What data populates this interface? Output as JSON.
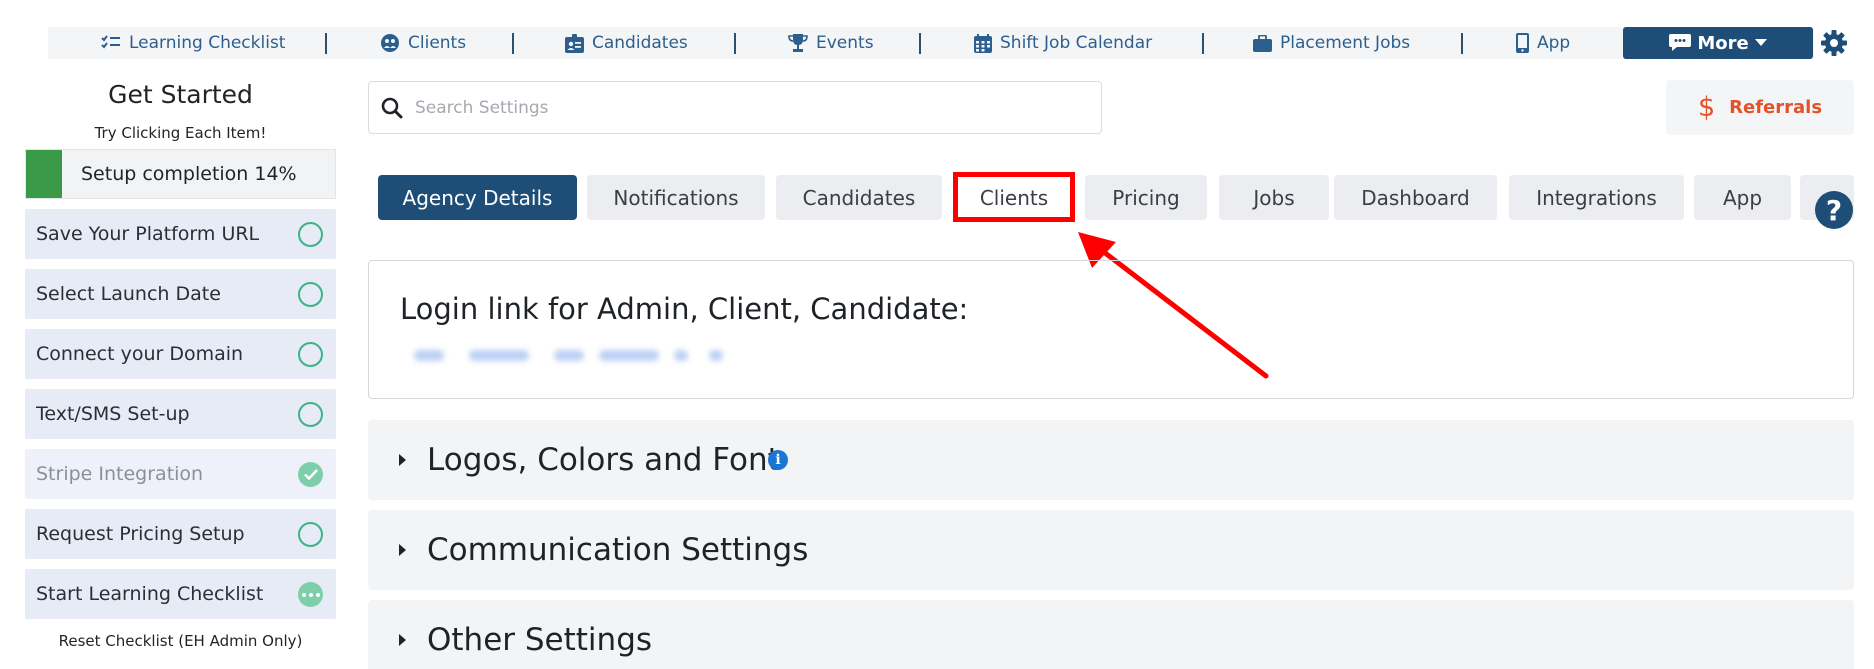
{
  "topnav": {
    "items": [
      {
        "label": "Learning Checklist",
        "icon": "checklist-icon"
      },
      {
        "label": "Clients",
        "icon": "clients-icon"
      },
      {
        "label": "Candidates",
        "icon": "id-badge-icon"
      },
      {
        "label": "Events",
        "icon": "trophy-icon"
      },
      {
        "label": "Shift Job Calendar",
        "icon": "calendar-icon"
      },
      {
        "label": "Placement Jobs",
        "icon": "briefcase-icon"
      },
      {
        "label": "App",
        "icon": "mobile-icon"
      }
    ],
    "more_label": "More",
    "settings_icon": "gear-icon"
  },
  "sidebar": {
    "title": "Get Started",
    "subtitle": "Try Clicking Each Item!",
    "progress": {
      "label": "Setup completion 14%",
      "percent": 14,
      "color": "#3a9a47"
    },
    "items": [
      {
        "label": "Save Your Platform URL",
        "status": "open"
      },
      {
        "label": "Select Launch Date",
        "status": "open"
      },
      {
        "label": "Connect your Domain",
        "status": "open"
      },
      {
        "label": "Text/SMS Set-up",
        "status": "open"
      },
      {
        "label": "Stripe Integration",
        "status": "done"
      },
      {
        "label": "Request Pricing Setup",
        "status": "open"
      },
      {
        "label": "Start Learning Checklist",
        "status": "in-progress"
      }
    ],
    "reset_label": "Reset Checklist (EH Admin Only)"
  },
  "search": {
    "placeholder": "Search Settings",
    "value": ""
  },
  "referrals": {
    "symbol": "$",
    "label": "Referrals",
    "color": "#e4522a"
  },
  "tabs": [
    {
      "label": "Agency Details",
      "active": true
    },
    {
      "label": "Notifications",
      "active": false
    },
    {
      "label": "Candidates",
      "active": false
    },
    {
      "label": "Clients",
      "active": false,
      "highlighted": true
    },
    {
      "label": "Pricing",
      "active": false
    },
    {
      "label": "Jobs",
      "active": false
    },
    {
      "label": "Dashboard",
      "active": false
    },
    {
      "label": "Integrations",
      "active": false
    },
    {
      "label": "App",
      "active": false
    }
  ],
  "help": {
    "label": "?"
  },
  "login": {
    "title": "Login link for Admin, Client, Candidate:"
  },
  "sections": [
    {
      "label": "Logos, Colors and Font",
      "info": "i"
    },
    {
      "label": "Communication Settings"
    },
    {
      "label": "Other Settings"
    }
  ],
  "colors": {
    "primary": "#1e4d78",
    "accent": "#e4522a",
    "success": "#3ab487",
    "annotation": "#ff0000"
  }
}
